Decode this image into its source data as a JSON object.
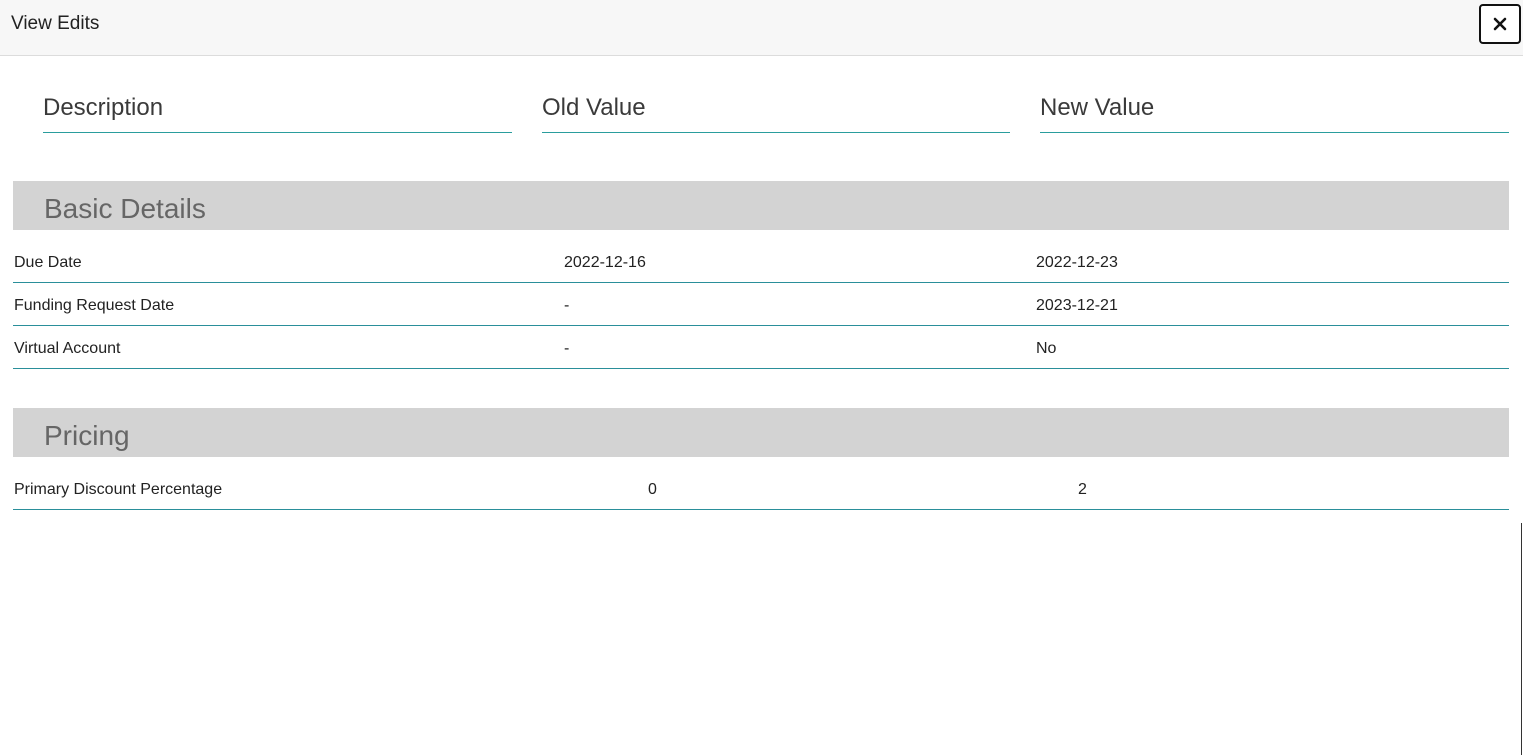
{
  "header": {
    "title": "View Edits",
    "close_icon": "close-icon"
  },
  "columns": {
    "description": "Description",
    "old_value": "Old Value",
    "new_value": "New Value"
  },
  "sections": [
    {
      "title": "Basic Details",
      "rows": [
        {
          "description": "Due Date",
          "old": "2022-12-16",
          "new": "2022-12-23"
        },
        {
          "description": "Funding Request Date",
          "old": "-",
          "new": "2023-12-21"
        },
        {
          "description": "Virtual Account",
          "old": "-",
          "new": "No"
        }
      ]
    },
    {
      "title": "Pricing",
      "rows": [
        {
          "description": "Primary Discount Percentage",
          "old": "0",
          "new": "2"
        }
      ]
    }
  ],
  "colors": {
    "accent": "#2a9d9d",
    "section_band": "#d3d3d3",
    "header_bg": "#f7f7f7"
  }
}
